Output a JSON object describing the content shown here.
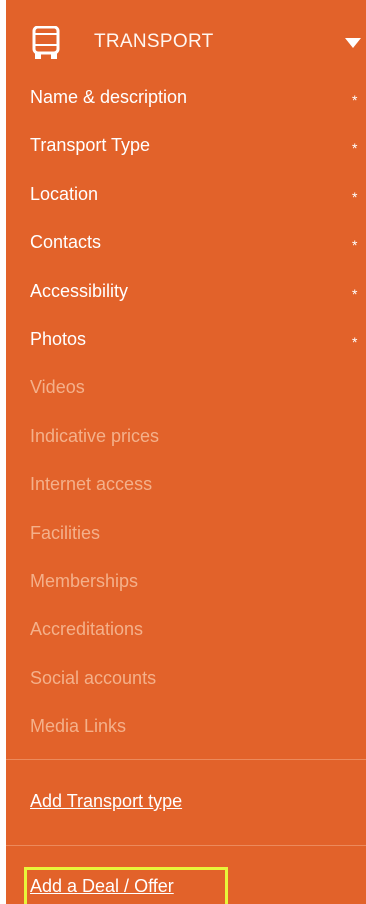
{
  "header": {
    "title": "TRANSPORT",
    "icon": "bus-icon",
    "toggle_icon": "caret-down-icon"
  },
  "menu": {
    "required_marker": "*",
    "items": [
      {
        "label": "Name & description",
        "required": true
      },
      {
        "label": "Transport Type",
        "required": true
      },
      {
        "label": "Location",
        "required": true
      },
      {
        "label": "Contacts",
        "required": true
      },
      {
        "label": "Accessibility",
        "required": true
      },
      {
        "label": "Photos",
        "required": true
      },
      {
        "label": "Videos",
        "required": false
      },
      {
        "label": "Indicative prices",
        "required": false
      },
      {
        "label": "Internet access",
        "required": false
      },
      {
        "label": "Facilities",
        "required": false
      },
      {
        "label": "Memberships",
        "required": false
      },
      {
        "label": "Accreditations",
        "required": false
      },
      {
        "label": "Social accounts",
        "required": false
      },
      {
        "label": "Media Links",
        "required": false
      }
    ]
  },
  "links": {
    "add_transport_type": "Add Transport type",
    "add_deal_offer": "Add a Deal / Offer"
  },
  "colors": {
    "panel_bg": "#e2622a",
    "required_text": "#ffffff",
    "optional_text": "#f4b08a",
    "highlight": "#e8f53a"
  }
}
